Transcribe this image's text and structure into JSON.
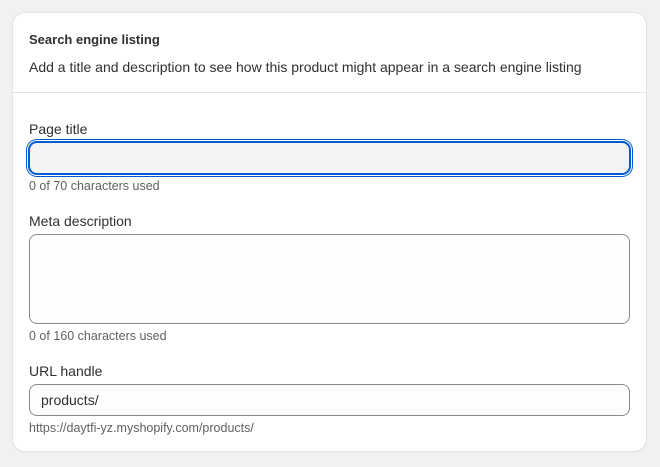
{
  "section": {
    "title": "Search engine listing",
    "subtitle": "Add a title and description to see how this product might appear in a search engine listing"
  },
  "page_title": {
    "label": "Page title",
    "value": "",
    "help": "0 of 70 characters used"
  },
  "meta_description": {
    "label": "Meta description",
    "value": "",
    "help": "0 of 160 characters used"
  },
  "url_handle": {
    "label": "URL handle",
    "value": "products/",
    "help": "https://daytfi-yz.myshopify.com/products/"
  },
  "colors": {
    "focus_ring": "#005bd3",
    "page_background": "#f1f1f1",
    "card_background": "#ffffff"
  }
}
